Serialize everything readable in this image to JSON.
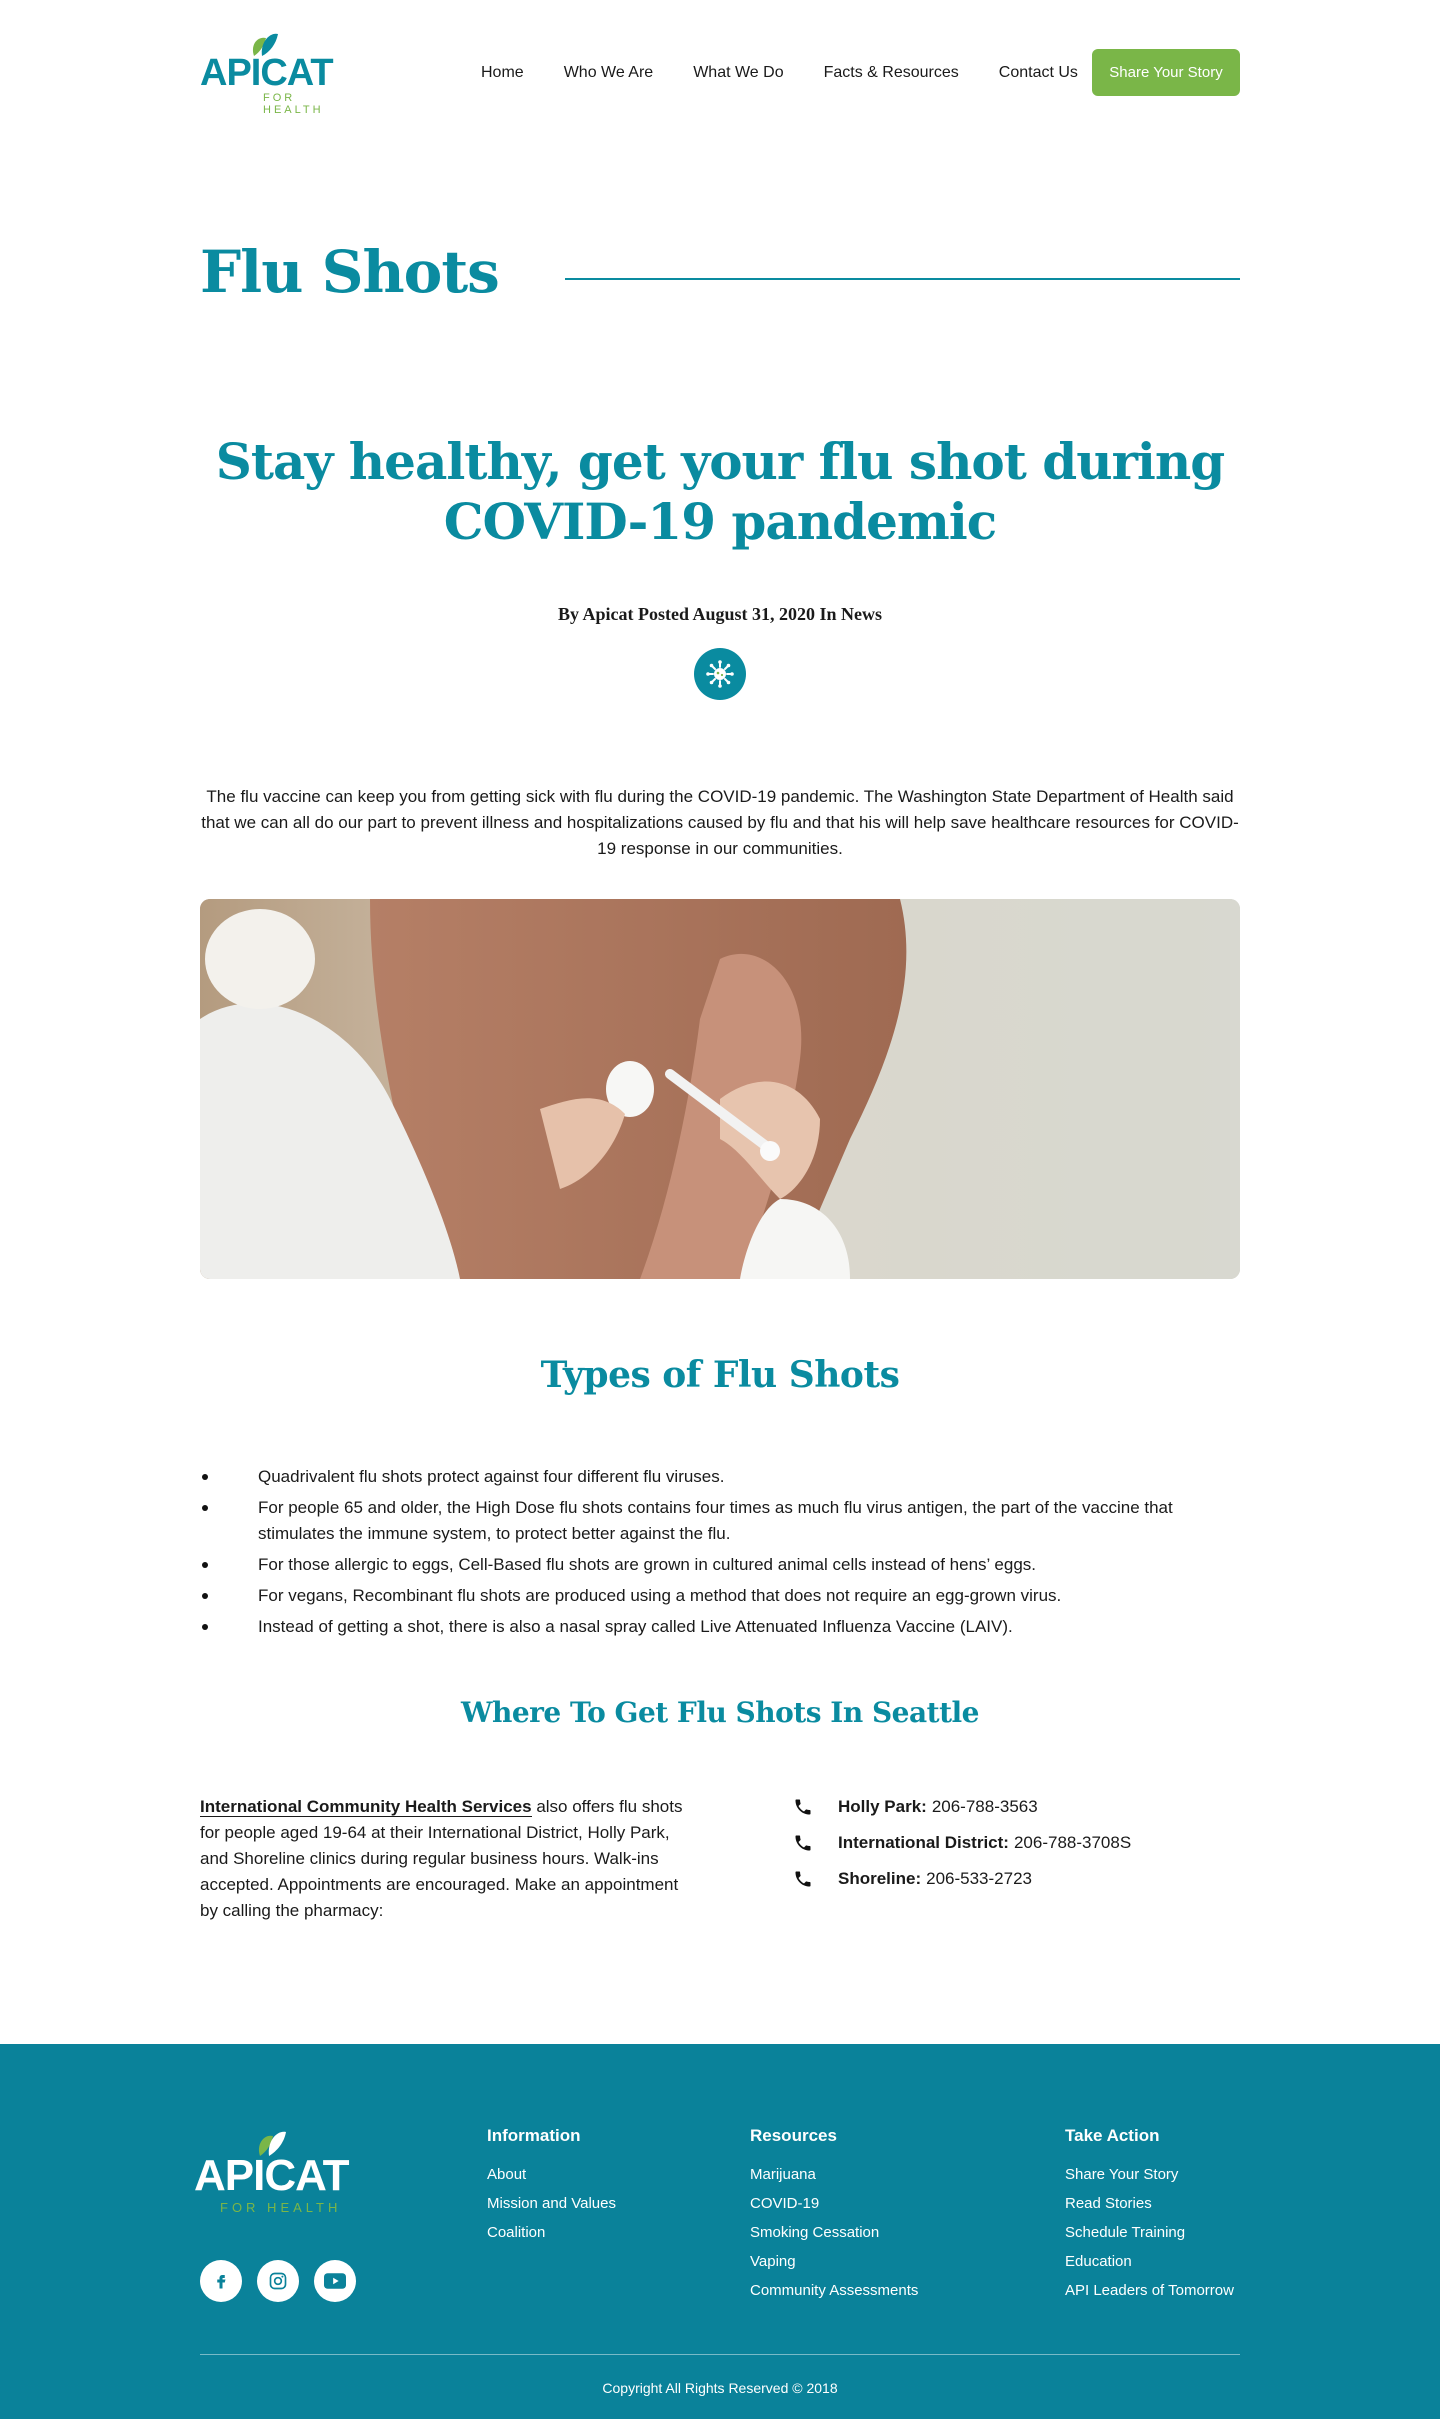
{
  "header": {
    "logo_text": "APICAT",
    "logo_tagline": "FOR HEALTH",
    "nav": [
      "Home",
      "Who We Are",
      "What We Do",
      "Facts & Resources",
      "Contact Us"
    ],
    "cta": "Share Your Story"
  },
  "page": {
    "title": "Flu Shots"
  },
  "article": {
    "headline": "Stay healthy, get your flu shot during COVID-19 pandemic",
    "byline": "By Apicat Posted August 31, 2020 In News",
    "intro": "The flu vaccine can keep you from getting sick with flu during the COVID-19 pandemic. The Washington State Department of Health said that we can all do our part to prevent illness and hospitalizations caused by flu and that his will help save healthcare resources for COVID-19 response in our communities.",
    "types_title": "Types of Flu Shots",
    "types": [
      "Quadrivalent flu shots protect against four different flu viruses.",
      "For people 65 and older, the High Dose flu shots contains four times as much flu virus antigen, the part of the vaccine that stimulates the immune system, to protect better against the flu.",
      "For those allergic to eggs, Cell-Based flu shots are grown in cultured animal cells instead of hens’ eggs.",
      "For vegans, Recombinant flu shots are produced using a method that does not require an egg-grown virus.",
      "Instead of getting a shot, there is also a nasal spray called Live Attenuated Influenza Vaccine (LAIV)."
    ],
    "where_title": "Where To Get Flu Shots In Seattle",
    "where_link": "International Community Health Services",
    "where_text": " also offers flu shots for people aged 19-64 at their International District, Holly Park, and Shoreline clinics during regular business hours. Walk-ins accepted. Appointments are encouraged. Make an appointment by calling the pharmacy:",
    "phones": [
      {
        "label": "Holly Park:",
        "number": "206-788-3563"
      },
      {
        "label": "International District:",
        "number": "206-788-3708S"
      },
      {
        "label": "Shoreline:",
        "number": "206-533-2723"
      }
    ]
  },
  "footer": {
    "logo_text": "APICAT",
    "logo_tagline": "FOR HEALTH",
    "columns": [
      {
        "title": "Information",
        "items": [
          "About",
          "Mission and Values",
          "Coalition"
        ]
      },
      {
        "title": "Resources",
        "items": [
          "Marijuana",
          "COVID-19",
          "Smoking Cessation",
          "Vaping",
          "Community Assessments"
        ]
      },
      {
        "title": "Take Action",
        "items": [
          "Share Your Story",
          "Read Stories",
          "Schedule Training",
          "Education",
          "API Leaders of Tomorrow"
        ]
      }
    ],
    "socials": [
      "facebook-icon",
      "instagram-icon",
      "youtube-icon"
    ],
    "copyright": "Copyright All Rights Reserved © 2018"
  },
  "colors": {
    "brand_teal": "#0a8ba0",
    "brand_green": "#7ab648",
    "footer_bg": "#0a829a"
  }
}
